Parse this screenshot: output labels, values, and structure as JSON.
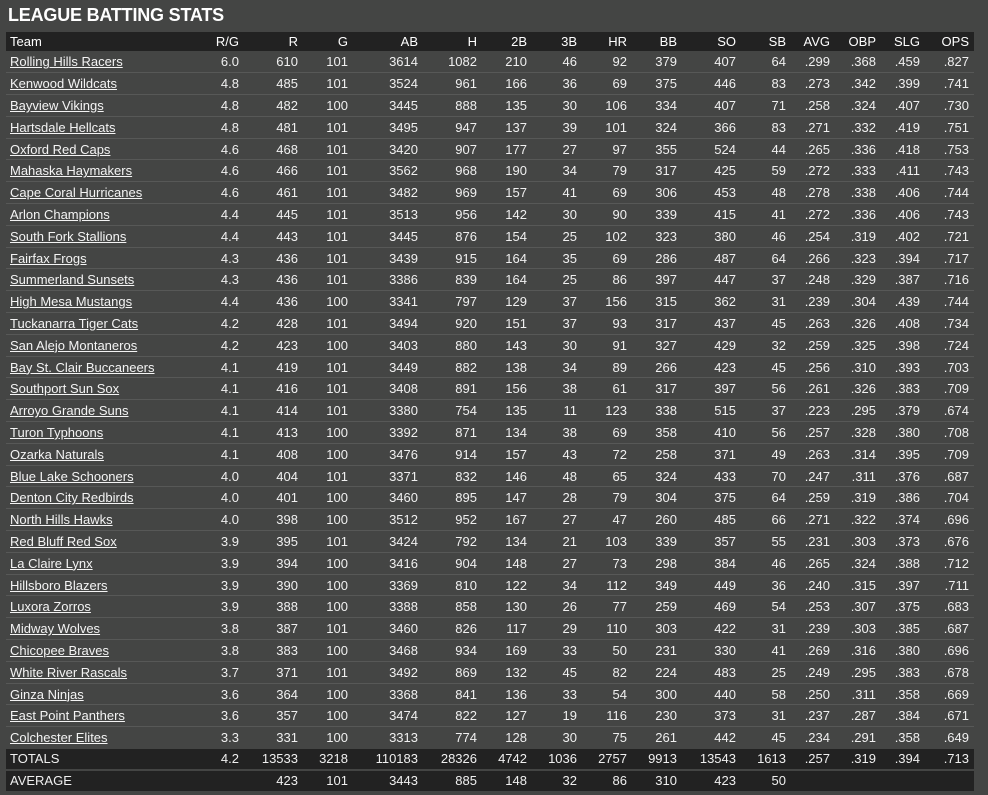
{
  "title": "LEAGUE BATTING STATS",
  "columns": [
    "Team",
    "R/G",
    "R",
    "G",
    "AB",
    "H",
    "2B",
    "3B",
    "HR",
    "BB",
    "SO",
    "SB",
    "AVG",
    "OBP",
    "SLG",
    "OPS"
  ],
  "rows": [
    [
      "Rolling Hills Racers",
      "6.0",
      "610",
      "101",
      "3614",
      "1082",
      "210",
      "46",
      "92",
      "379",
      "407",
      "64",
      ".299",
      ".368",
      ".459",
      ".827"
    ],
    [
      "Kenwood Wildcats",
      "4.8",
      "485",
      "101",
      "3524",
      "961",
      "166",
      "36",
      "69",
      "375",
      "446",
      "83",
      ".273",
      ".342",
      ".399",
      ".741"
    ],
    [
      "Bayview Vikings",
      "4.8",
      "482",
      "100",
      "3445",
      "888",
      "135",
      "30",
      "106",
      "334",
      "407",
      "71",
      ".258",
      ".324",
      ".407",
      ".730"
    ],
    [
      "Hartsdale Hellcats",
      "4.8",
      "481",
      "101",
      "3495",
      "947",
      "137",
      "39",
      "101",
      "324",
      "366",
      "83",
      ".271",
      ".332",
      ".419",
      ".751"
    ],
    [
      "Oxford Red Caps",
      "4.6",
      "468",
      "101",
      "3420",
      "907",
      "177",
      "27",
      "97",
      "355",
      "524",
      "44",
      ".265",
      ".336",
      ".418",
      ".753"
    ],
    [
      "Mahaska Haymakers",
      "4.6",
      "466",
      "101",
      "3562",
      "968",
      "190",
      "34",
      "79",
      "317",
      "425",
      "59",
      ".272",
      ".333",
      ".411",
      ".743"
    ],
    [
      "Cape Coral Hurricanes",
      "4.6",
      "461",
      "101",
      "3482",
      "969",
      "157",
      "41",
      "69",
      "306",
      "453",
      "48",
      ".278",
      ".338",
      ".406",
      ".744"
    ],
    [
      "Arlon Champions",
      "4.4",
      "445",
      "101",
      "3513",
      "956",
      "142",
      "30",
      "90",
      "339",
      "415",
      "41",
      ".272",
      ".336",
      ".406",
      ".743"
    ],
    [
      "South Fork Stallions",
      "4.4",
      "443",
      "101",
      "3445",
      "876",
      "154",
      "25",
      "102",
      "323",
      "380",
      "46",
      ".254",
      ".319",
      ".402",
      ".721"
    ],
    [
      "Fairfax Frogs",
      "4.3",
      "436",
      "101",
      "3439",
      "915",
      "164",
      "35",
      "69",
      "286",
      "487",
      "64",
      ".266",
      ".323",
      ".394",
      ".717"
    ],
    [
      "Summerland Sunsets",
      "4.3",
      "436",
      "101",
      "3386",
      "839",
      "164",
      "25",
      "86",
      "397",
      "447",
      "37",
      ".248",
      ".329",
      ".387",
      ".716"
    ],
    [
      "High Mesa Mustangs",
      "4.4",
      "436",
      "100",
      "3341",
      "797",
      "129",
      "37",
      "156",
      "315",
      "362",
      "31",
      ".239",
      ".304",
      ".439",
      ".744"
    ],
    [
      "Tuckanarra Tiger Cats",
      "4.2",
      "428",
      "101",
      "3494",
      "920",
      "151",
      "37",
      "93",
      "317",
      "437",
      "45",
      ".263",
      ".326",
      ".408",
      ".734"
    ],
    [
      "San Alejo Montaneros",
      "4.2",
      "423",
      "100",
      "3403",
      "880",
      "143",
      "30",
      "91",
      "327",
      "429",
      "32",
      ".259",
      ".325",
      ".398",
      ".724"
    ],
    [
      "Bay St. Clair Buccaneers",
      "4.1",
      "419",
      "101",
      "3449",
      "882",
      "138",
      "34",
      "89",
      "266",
      "423",
      "45",
      ".256",
      ".310",
      ".393",
      ".703"
    ],
    [
      "Southport Sun Sox",
      "4.1",
      "416",
      "101",
      "3408",
      "891",
      "156",
      "38",
      "61",
      "317",
      "397",
      "56",
      ".261",
      ".326",
      ".383",
      ".709"
    ],
    [
      "Arroyo Grande Suns",
      "4.1",
      "414",
      "101",
      "3380",
      "754",
      "135",
      "11",
      "123",
      "338",
      "515",
      "37",
      ".223",
      ".295",
      ".379",
      ".674"
    ],
    [
      "Turon Typhoons",
      "4.1",
      "413",
      "100",
      "3392",
      "871",
      "134",
      "38",
      "69",
      "358",
      "410",
      "56",
      ".257",
      ".328",
      ".380",
      ".708"
    ],
    [
      "Ozarka Naturals",
      "4.1",
      "408",
      "100",
      "3476",
      "914",
      "157",
      "43",
      "72",
      "258",
      "371",
      "49",
      ".263",
      ".314",
      ".395",
      ".709"
    ],
    [
      "Blue Lake Schooners",
      "4.0",
      "404",
      "101",
      "3371",
      "832",
      "146",
      "48",
      "65",
      "324",
      "433",
      "70",
      ".247",
      ".311",
      ".376",
      ".687"
    ],
    [
      "Denton City Redbirds",
      "4.0",
      "401",
      "100",
      "3460",
      "895",
      "147",
      "28",
      "79",
      "304",
      "375",
      "64",
      ".259",
      ".319",
      ".386",
      ".704"
    ],
    [
      "North Hills Hawks",
      "4.0",
      "398",
      "100",
      "3512",
      "952",
      "167",
      "27",
      "47",
      "260",
      "485",
      "66",
      ".271",
      ".322",
      ".374",
      ".696"
    ],
    [
      "Red Bluff Red Sox",
      "3.9",
      "395",
      "101",
      "3424",
      "792",
      "134",
      "21",
      "103",
      "339",
      "357",
      "55",
      ".231",
      ".303",
      ".373",
      ".676"
    ],
    [
      "La Claire Lynx",
      "3.9",
      "394",
      "100",
      "3416",
      "904",
      "148",
      "27",
      "73",
      "298",
      "384",
      "46",
      ".265",
      ".324",
      ".388",
      ".712"
    ],
    [
      "Hillsboro Blazers",
      "3.9",
      "390",
      "100",
      "3369",
      "810",
      "122",
      "34",
      "112",
      "349",
      "449",
      "36",
      ".240",
      ".315",
      ".397",
      ".711"
    ],
    [
      "Luxora Zorros",
      "3.9",
      "388",
      "100",
      "3388",
      "858",
      "130",
      "26",
      "77",
      "259",
      "469",
      "54",
      ".253",
      ".307",
      ".375",
      ".683"
    ],
    [
      "Midway Wolves",
      "3.8",
      "387",
      "101",
      "3460",
      "826",
      "117",
      "29",
      "110",
      "303",
      "422",
      "31",
      ".239",
      ".303",
      ".385",
      ".687"
    ],
    [
      "Chicopee Braves",
      "3.8",
      "383",
      "100",
      "3468",
      "934",
      "169",
      "33",
      "50",
      "231",
      "330",
      "41",
      ".269",
      ".316",
      ".380",
      ".696"
    ],
    [
      "White River Rascals",
      "3.7",
      "371",
      "101",
      "3492",
      "869",
      "132",
      "45",
      "82",
      "224",
      "483",
      "25",
      ".249",
      ".295",
      ".383",
      ".678"
    ],
    [
      "Ginza Ninjas",
      "3.6",
      "364",
      "100",
      "3368",
      "841",
      "136",
      "33",
      "54",
      "300",
      "440",
      "58",
      ".250",
      ".311",
      ".358",
      ".669"
    ],
    [
      "East Point Panthers",
      "3.6",
      "357",
      "100",
      "3474",
      "822",
      "127",
      "19",
      "116",
      "230",
      "373",
      "31",
      ".237",
      ".287",
      ".384",
      ".671"
    ],
    [
      "Colchester Elites",
      "3.3",
      "331",
      "100",
      "3313",
      "774",
      "128",
      "30",
      "75",
      "261",
      "442",
      "45",
      ".234",
      ".291",
      ".358",
      ".649"
    ]
  ],
  "totals": [
    "TOTALS",
    "4.2",
    "13533",
    "3218",
    "110183",
    "28326",
    "4742",
    "1036",
    "2757",
    "9913",
    "13543",
    "1613",
    ".257",
    ".319",
    ".394",
    ".713"
  ],
  "average": [
    "AVERAGE",
    "",
    "423",
    "101",
    "3443",
    "885",
    "148",
    "32",
    "86",
    "310",
    "423",
    "50",
    "",
    "",
    "",
    ""
  ]
}
